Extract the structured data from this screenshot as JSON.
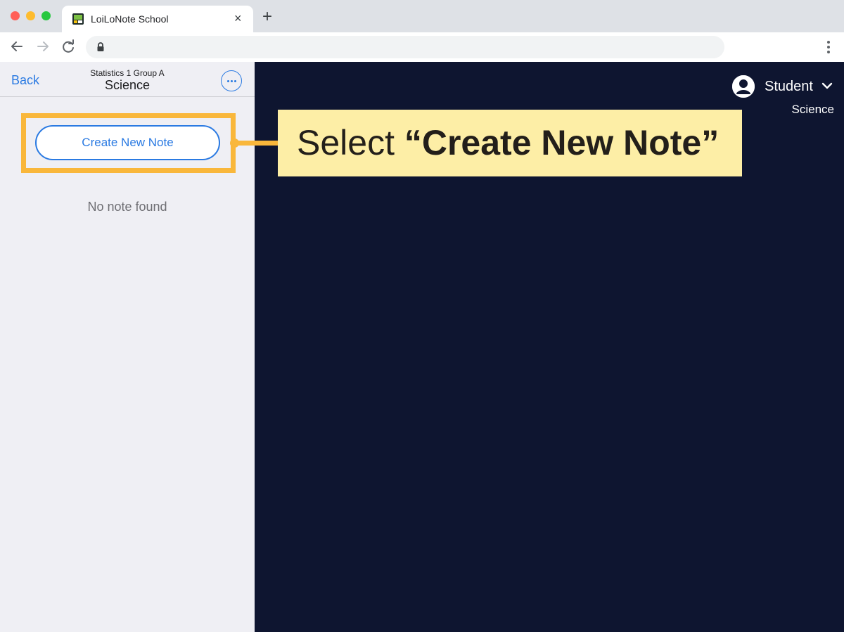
{
  "browser": {
    "tab_title": "LoiLoNote School",
    "tab_close": "×",
    "new_tab": "+",
    "icons": [
      "back-arrow-icon",
      "forward-arrow-icon",
      "reload-icon",
      "lock-icon",
      "menu-icon"
    ]
  },
  "left_panel": {
    "back_label": "Back",
    "header_subtitle": "Statistics 1 Group A",
    "header_title": "Science",
    "create_button_label": "Create New Note",
    "empty_message": "No note found"
  },
  "user_menu": {
    "name": "Student",
    "class_name": "Science"
  },
  "callout": {
    "prefix": "Select ",
    "emphasis": "“Create New Note”"
  },
  "colors": {
    "accent": "#2a7ae2",
    "highlight": "#f9b73b",
    "callout_bg": "#fdeea6",
    "dark_bg": "#0e1530"
  }
}
